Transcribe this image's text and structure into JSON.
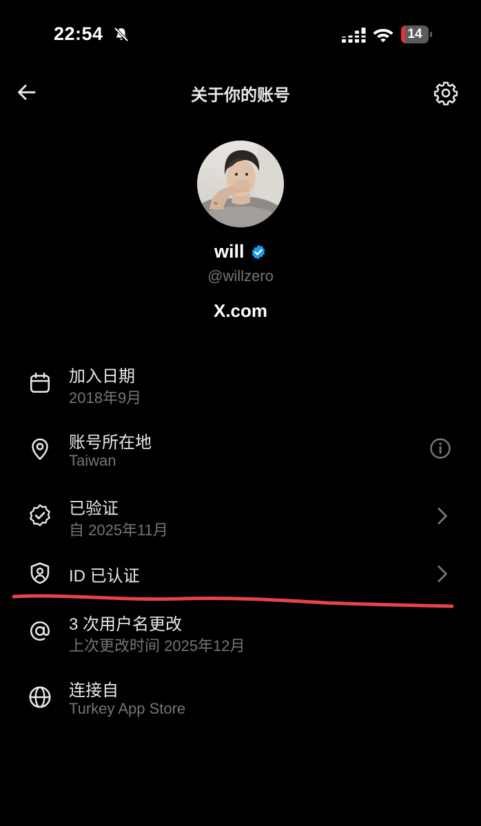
{
  "status_bar": {
    "time": "22:54",
    "battery_level": "14",
    "battery_fraction": 0.14,
    "icons": [
      "bell-slash-icon",
      "cellular-signal-icon",
      "wifi-icon",
      "battery-icon"
    ]
  },
  "header": {
    "title": "关于你的账号",
    "back_icon": "arrow-left-icon",
    "settings_icon": "gear-icon"
  },
  "profile": {
    "display_name": "will",
    "username": "@willzero",
    "site": "X.com",
    "verified_badge_color": "#1d9bf0"
  },
  "info_items": [
    {
      "title": "加入日期",
      "subtitle": "2018年9月",
      "icon": "calendar-icon"
    },
    {
      "title": "账号所在地",
      "subtitle": "Taiwan",
      "icon": "location-pin-icon",
      "trailing_icon": "info-icon"
    },
    {
      "title": "已验证",
      "subtitle": "自 2025年11月",
      "icon": "verified-seal-icon",
      "trailing_icon": "chevron-right-icon"
    },
    {
      "title": "ID 已认证",
      "icon": "shield-person-icon",
      "trailing_icon": "chevron-right-icon"
    },
    {
      "title": "3 次用户名更改",
      "subtitle": "上次更改时间 2025年12月",
      "icon": "at-sign-icon"
    },
    {
      "title": "连接自",
      "subtitle": "Turkey App Store",
      "icon": "globe-icon"
    }
  ],
  "colors": {
    "background": "#000000",
    "primary_text": "#e7e9ea",
    "secondary_text": "#71767b",
    "annotation_red": "#e8434a",
    "battery_low": "#e0342f"
  }
}
